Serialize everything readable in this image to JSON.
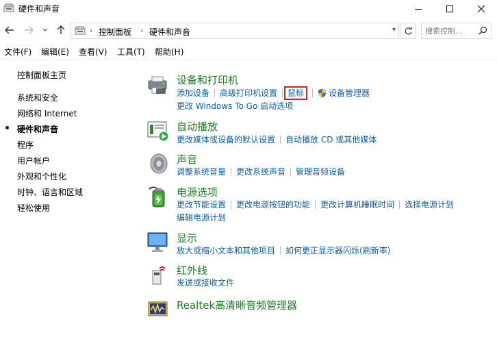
{
  "window": {
    "title": "硬件和声音"
  },
  "navigation": {
    "breadcrumbs": [
      "控制面板",
      "硬件和声音"
    ],
    "search_placeholder": "搜索控制..."
  },
  "menu": [
    "文件(F)",
    "编辑(E)",
    "查看(V)",
    "工具(T)",
    "帮助(H)"
  ],
  "sidebar": {
    "items": [
      "控制面板主页",
      "系统和安全",
      "网络和 Internet",
      "硬件和声音",
      "程序",
      "用户帐户",
      "外观和个性化",
      "时钟、语言和区域",
      "轻松使用"
    ],
    "active_index": 3
  },
  "categories": [
    {
      "title": "设备和打印机",
      "icon": "printer-icon",
      "links": [
        "添加设备",
        "高级打印机设置",
        "鼠标",
        "设备管理器",
        "更改 Windows To Go 启动选项"
      ],
      "highlighted_link": "鼠标"
    },
    {
      "title": "自动播放",
      "icon": "autoplay-icon",
      "links": [
        "更改媒体或设备的默认设置",
        "自动播放 CD 或其他媒体"
      ]
    },
    {
      "title": "声音",
      "icon": "speaker-icon",
      "links": [
        "调整系统音量",
        "更改系统声音",
        "管理音频设备"
      ]
    },
    {
      "title": "电源选项",
      "icon": "battery-icon",
      "links": [
        "更改节能设置",
        "更改电源按钮的功能",
        "更改计算机睡眠时间",
        "选择电源计划",
        "编辑电源计划"
      ]
    },
    {
      "title": "显示",
      "icon": "monitor-icon",
      "links": [
        "放大或缩小文本和其他项目",
        "如何更正显示器闪烁(刷新率)"
      ]
    },
    {
      "title": "红外线",
      "icon": "infrared-icon",
      "links": [
        "发送或接收文件"
      ]
    },
    {
      "title": "Realtek高清晰音频管理器",
      "icon": "realtek-audio-icon",
      "links": []
    }
  ],
  "colors": {
    "category_title": "#1e7a27",
    "link": "#0a5fa7",
    "highlight_border": "#d9231c"
  }
}
